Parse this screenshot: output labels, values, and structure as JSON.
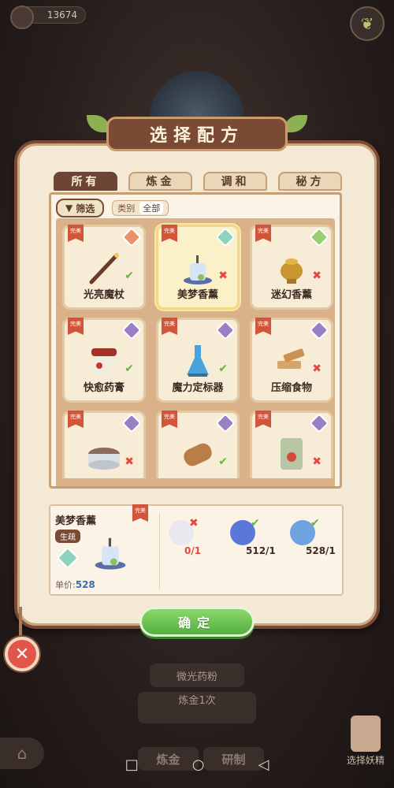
{
  "currency": {
    "amount": "13674"
  },
  "title": "选择配方",
  "tabs": [
    {
      "label": "所有",
      "active": true
    },
    {
      "label": "炼金",
      "active": false
    },
    {
      "label": "调和",
      "active": false
    },
    {
      "label": "秘方",
      "active": false
    }
  ],
  "filter": {
    "label": "筛选",
    "category_label": "类别",
    "category_value": "全部"
  },
  "ribbon_text": "完美",
  "recipes": [
    {
      "name": "光亮魔杖",
      "status": "ok",
      "gem": "orange-diamond-icon",
      "gem_color": "#e8916a",
      "art": "wand-icon"
    },
    {
      "name": "美梦香薰",
      "status": "no",
      "gem": "teal-diamond-icon",
      "gem_color": "#8fd2c0",
      "art": "incense-icon",
      "selected": true
    },
    {
      "name": "迷幻香薰",
      "status": "no",
      "gem": "green-diamond-icon",
      "gem_color": "#9bcf72",
      "art": "censer-icon"
    },
    {
      "name": "快愈药膏",
      "status": "ok",
      "gem": "purple-diamond-icon",
      "gem_color": "#9a7fc4",
      "art": "ointment-jar-icon"
    },
    {
      "name": "魔力定标器",
      "status": "ok",
      "gem": "purple-diamond-icon",
      "gem_color": "#9a7fc4",
      "art": "blue-flask-icon"
    },
    {
      "name": "压缩食物",
      "status": "no",
      "gem": "purple-diamond-icon",
      "gem_color": "#9a7fc4",
      "art": "food-bars-icon"
    },
    {
      "name": "",
      "status": "no",
      "gem": "purple-diamond-icon",
      "gem_color": "#9a7fc4",
      "art": "salve-tin-icon"
    },
    {
      "name": "",
      "status": "ok",
      "gem": "purple-diamond-icon",
      "gem_color": "#9a7fc4",
      "art": "scroll-icon"
    },
    {
      "name": "",
      "status": "no",
      "gem": "purple-diamond-icon",
      "gem_color": "#9a7fc4",
      "art": "fertilizer-bag-icon"
    }
  ],
  "detail": {
    "name": "美梦香薰",
    "badge": "生疏",
    "price_label": "单价:",
    "price": "528",
    "ingredients": [
      {
        "art": "cotton-ball-icon",
        "color": "#e8e8ee",
        "count": "0/1",
        "status": "no"
      },
      {
        "art": "blue-flower-icon",
        "color": "#5a78d6",
        "count": "512/1",
        "status": "ok"
      },
      {
        "art": "blue-pinwheel-flower-icon",
        "color": "#6fa3e0",
        "count": "528/1",
        "status": "ok"
      }
    ]
  },
  "confirm_label": "确定",
  "close_label": "✕",
  "background": {
    "item_label": "微光药粉",
    "count_label": "炼金1次",
    "bottom_tabs": [
      "炼金",
      "研制"
    ],
    "spirit_label": "选择妖精"
  },
  "nav": {
    "square": "□",
    "circle": "○",
    "back": "◁"
  }
}
